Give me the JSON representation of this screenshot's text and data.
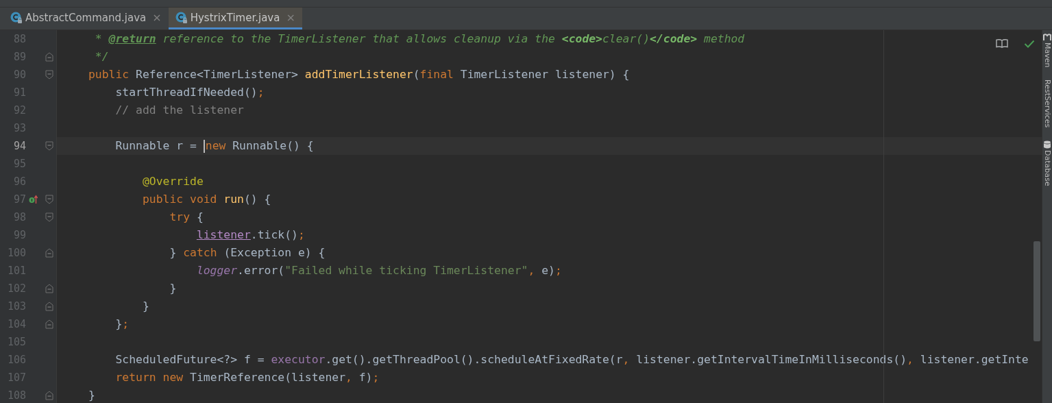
{
  "tabs": [
    {
      "label": "AbstractCommand.java",
      "selected": false,
      "close": "×"
    },
    {
      "label": "HystrixTimer.java",
      "selected": true,
      "close": "×"
    }
  ],
  "lines": [
    {
      "number": "88",
      "current": false,
      "fold_start": false,
      "fold_end": false,
      "tokens": [
        {
          "kind": "doc",
          "text": " * "
        },
        {
          "kind": "doctag",
          "text": "@return"
        },
        {
          "kind": "doc",
          "text": " reference to the TimerListener that allows cleanup via the "
        },
        {
          "kind": "docbold",
          "text": "<code>"
        },
        {
          "kind": "doc",
          "text": "clear()"
        },
        {
          "kind": "docbold",
          "text": "</code>"
        },
        {
          "kind": "doc",
          "text": " method"
        }
      ]
    },
    {
      "number": "89",
      "current": false,
      "fold_start": false,
      "fold_end": true,
      "tokens": [
        {
          "kind": "doc",
          "text": " */"
        }
      ]
    },
    {
      "number": "90",
      "current": false,
      "fold_start": true,
      "fold_end": false,
      "tokens": [
        {
          "kind": "kw",
          "text": "public "
        },
        {
          "kind": "plain",
          "text": "Reference<TimerListener> "
        },
        {
          "kind": "fn",
          "text": "addTimerListener"
        },
        {
          "kind": "plain",
          "text": "("
        },
        {
          "kind": "kw",
          "text": "final "
        },
        {
          "kind": "plain",
          "text": "TimerListener listener) {"
        }
      ],
      "children": [
        {
          "number": "91",
          "current": false,
          "fold_start": false,
          "fold_end": false,
          "tokens": [
            {
              "kind": "plain",
              "text": "startThreadIfNeeded()"
            },
            {
              "kind": "kw",
              "text": ";"
            }
          ]
        },
        {
          "number": "92",
          "current": false,
          "fold_start": false,
          "fold_end": false,
          "tokens": [
            {
              "kind": "comment",
              "text": "// add the listener"
            }
          ]
        },
        {
          "number": "93",
          "current": false,
          "fold_start": false,
          "fold_end": false
        },
        {
          "number": "94",
          "current": true,
          "fold_start": true,
          "fold_end": false,
          "tokens": [
            {
              "kind": "plain",
              "text": "Runnable r = "
            },
            {
              "kind": "caret"
            },
            {
              "kind": "kw",
              "text": "new "
            },
            {
              "kind": "plain",
              "text": "Runnable() {"
            }
          ],
          "children": [
            {
              "number": "95",
              "current": false,
              "fold_start": false,
              "fold_end": false
            },
            {
              "number": "96",
              "current": false,
              "fold_start": false,
              "fold_end": false,
              "tokens": [
                {
                  "kind": "annotation",
                  "text": "@Override"
                }
              ]
            },
            {
              "number": "97",
              "current": false,
              "fold_start": true,
              "fold_end": false,
              "overrides": true,
              "tokens": [
                {
                  "kind": "kw",
                  "text": "public void "
                },
                {
                  "kind": "fn",
                  "text": "run"
                },
                {
                  "kind": "plain",
                  "text": "() {"
                }
              ],
              "children": [
                {
                  "number": "98",
                  "current": false,
                  "fold_start": true,
                  "fold_end": false,
                  "tokens": [
                    {
                      "kind": "kw",
                      "text": "try "
                    },
                    {
                      "kind": "plain",
                      "text": "{"
                    }
                  ],
                  "children": [
                    {
                      "number": "99",
                      "current": false,
                      "fold_start": false,
                      "fold_end": false,
                      "tokens": [
                        {
                          "kind": "captured",
                          "text": "listener"
                        },
                        {
                          "kind": "plain",
                          "text": ".tick()"
                        },
                        {
                          "kind": "kw",
                          "text": ";"
                        }
                      ]
                    }
                  ]
                },
                {
                  "number": "100",
                  "current": false,
                  "fold_start": false,
                  "fold_end": true,
                  "tokens": [
                    {
                      "kind": "plain",
                      "text": "} "
                    },
                    {
                      "kind": "kw",
                      "text": "catch "
                    },
                    {
                      "kind": "plain",
                      "text": "(Exception e) {"
                    }
                  ],
                  "children": [
                    {
                      "number": "101",
                      "current": false,
                      "fold_start": false,
                      "fold_end": false,
                      "tokens": [
                        {
                          "kind": "static",
                          "text": "logger"
                        },
                        {
                          "kind": "plain",
                          "text": ".error("
                        },
                        {
                          "kind": "string",
                          "text": "\"Failed while ticking TimerListener\""
                        },
                        {
                          "kind": "kw",
                          "text": ", "
                        },
                        {
                          "kind": "plain",
                          "text": "e)"
                        },
                        {
                          "kind": "kw",
                          "text": ";"
                        }
                      ]
                    }
                  ]
                },
                {
                  "number": "102",
                  "current": false,
                  "fold_start": false,
                  "fold_end": true,
                  "tokens": [
                    {
                      "kind": "plain",
                      "text": "}"
                    }
                  ]
                }
              ]
            },
            {
              "number": "103",
              "current": false,
              "fold_start": false,
              "fold_end": true,
              "tokens": [
                {
                  "kind": "plain",
                  "text": "}"
                }
              ]
            }
          ]
        },
        {
          "number": "104",
          "current": false,
          "fold_start": false,
          "fold_end": true,
          "tokens": [
            {
              "kind": "plain",
              "text": "}"
            },
            {
              "kind": "kw",
              "text": ";"
            }
          ]
        },
        {
          "number": "105",
          "current": false,
          "fold_start": false,
          "fold_end": false
        },
        {
          "number": "106",
          "current": false,
          "fold_start": false,
          "fold_end": false,
          "tokens": [
            {
              "kind": "plain",
              "text": "ScheduledFuture<?> f = "
            },
            {
              "kind": "field",
              "text": "executor"
            },
            {
              "kind": "plain",
              "text": ".get().getThreadPool().scheduleAtFixedRate(r"
            },
            {
              "kind": "kw",
              "text": ", "
            },
            {
              "kind": "plain",
              "text": "listener.getIntervalTimeInMilliseconds()"
            },
            {
              "kind": "kw",
              "text": ", "
            },
            {
              "kind": "plain",
              "text": "listener.getInte"
            }
          ]
        },
        {
          "number": "107",
          "current": false,
          "fold_start": false,
          "fold_end": false,
          "tokens": [
            {
              "kind": "kw",
              "text": "return new "
            },
            {
              "kind": "plain",
              "text": "TimerReference(listener"
            },
            {
              "kind": "kw",
              "text": ", "
            },
            {
              "kind": "plain",
              "text": "f)"
            },
            {
              "kind": "kw",
              "text": ";"
            }
          ]
        }
      ]
    },
    {
      "number": "108",
      "current": false,
      "fold_start": false,
      "fold_end": true,
      "tokens": [
        {
          "kind": "plain",
          "text": "}"
        }
      ]
    }
  ],
  "side_tools": [
    {
      "kind": "maven",
      "label": "Maven"
    },
    {
      "kind": "rest",
      "label": "RestServices"
    },
    {
      "kind": "database",
      "label": "Database"
    }
  ]
}
